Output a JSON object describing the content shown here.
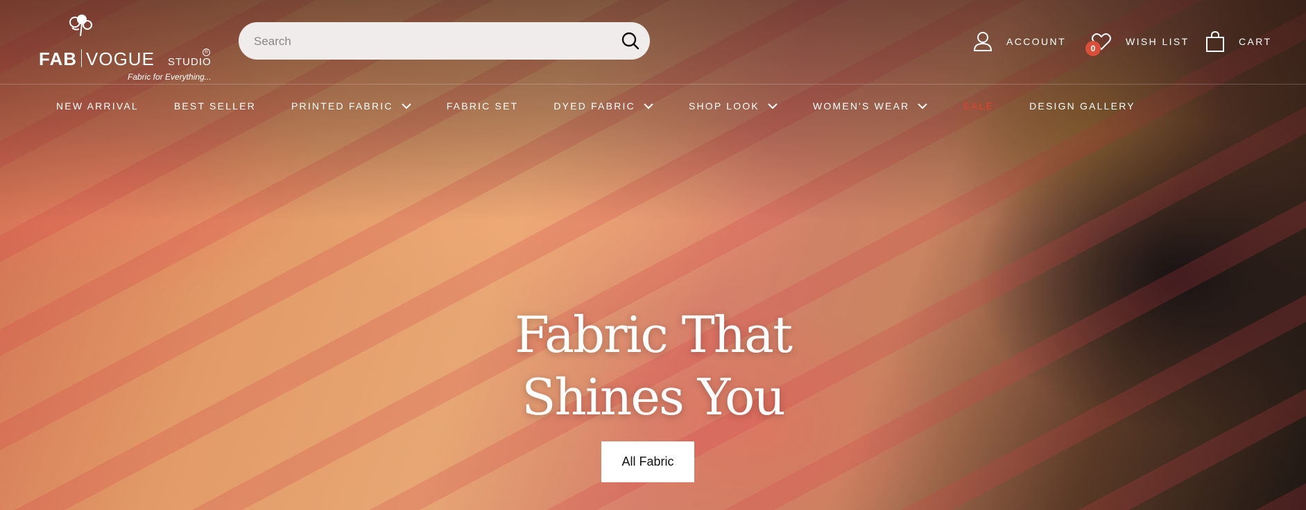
{
  "brand": {
    "name_bold": "FAB",
    "name_rest": "VOGUE",
    "studio": "STUDIO",
    "reg_mark": "®",
    "tagline": "Fabric for Everything..."
  },
  "search": {
    "placeholder": "Search",
    "value": ""
  },
  "header_utils": {
    "account_label": "ACCOUNT",
    "wishlist_label": "WISH LIST",
    "wishlist_count": "0",
    "cart_label": "CART"
  },
  "nav": {
    "items": [
      {
        "label": "NEW ARRIVAL"
      },
      {
        "label": "BEST SELLER"
      },
      {
        "label": "PRINTED FABRIC"
      },
      {
        "label": "FABRIC SET"
      },
      {
        "label": "DYED FABRIC"
      },
      {
        "label": "SHOP LOOK"
      },
      {
        "label": "WOMEN'S WEAR"
      },
      {
        "label": "SALE"
      },
      {
        "label": "DESIGN GALLERY"
      }
    ]
  },
  "hero": {
    "title_line1": "Fabric That",
    "title_line2": "Shines You",
    "cta_label": "All Fabric"
  },
  "colors": {
    "sale": "#e3402c",
    "badge": "#d9503a",
    "search_bg": "#efeceb"
  },
  "icons": [
    "flower-logo-icon",
    "search-icon",
    "account-icon",
    "heart-icon",
    "cart-bag-icon",
    "chevron-down-icon"
  ]
}
